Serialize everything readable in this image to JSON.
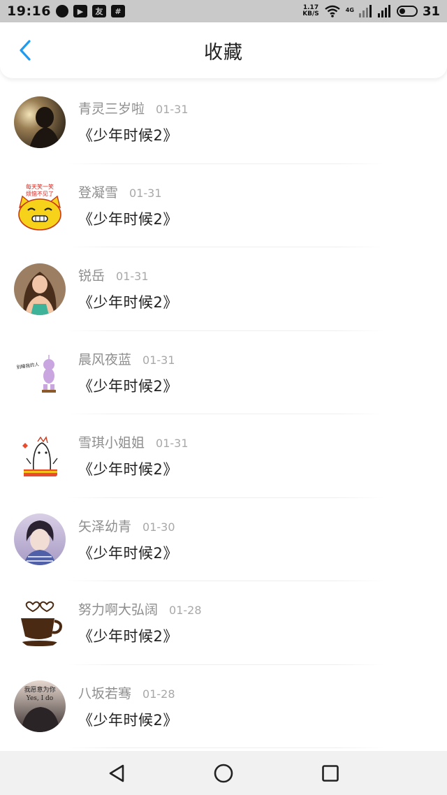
{
  "status_bar": {
    "time": "19:16",
    "net_speed_value": "1.17",
    "net_speed_unit": "KB/S",
    "network_type": "4G",
    "battery": "31",
    "notification_icons": [
      "chat-bubble-icon",
      "video-app-icon",
      "app-icon",
      "app-icon"
    ]
  },
  "header": {
    "title": "收藏",
    "back_icon": "chevron-left-icon",
    "accent_color": "#1e9bf0"
  },
  "items": [
    {
      "name": "青灵三岁啦",
      "date": "01-31",
      "work": "《少年时候2》"
    },
    {
      "name": "登凝雪",
      "date": "01-31",
      "work": "《少年时候2》"
    },
    {
      "name": "锐岳",
      "date": "01-31",
      "work": "《少年时候2》"
    },
    {
      "name": "晨风夜蓝",
      "date": "01-31",
      "work": "《少年时候2》"
    },
    {
      "name": "雪琪小姐姐",
      "date": "01-31",
      "work": "《少年时候2》"
    },
    {
      "name": "矢泽幼青",
      "date": "01-30",
      "work": "《少年时候2》"
    },
    {
      "name": "努力啊大弘阔",
      "date": "01-28",
      "work": "《少年时候2》"
    },
    {
      "name": "八坂若骞",
      "date": "01-28",
      "work": "《少年时候2》"
    }
  ],
  "avatar_texts": {
    "emoji_cat": [
      "每天笑一笑",
      "烦恼不见了"
    ],
    "phrase": "我愿意为你",
    "yes": "Yes, I do",
    "small_text": "别睡我的人"
  },
  "nav_bar": {
    "back": "triangle-back-icon",
    "home": "circle-home-icon",
    "recents": "square-recents-icon"
  }
}
